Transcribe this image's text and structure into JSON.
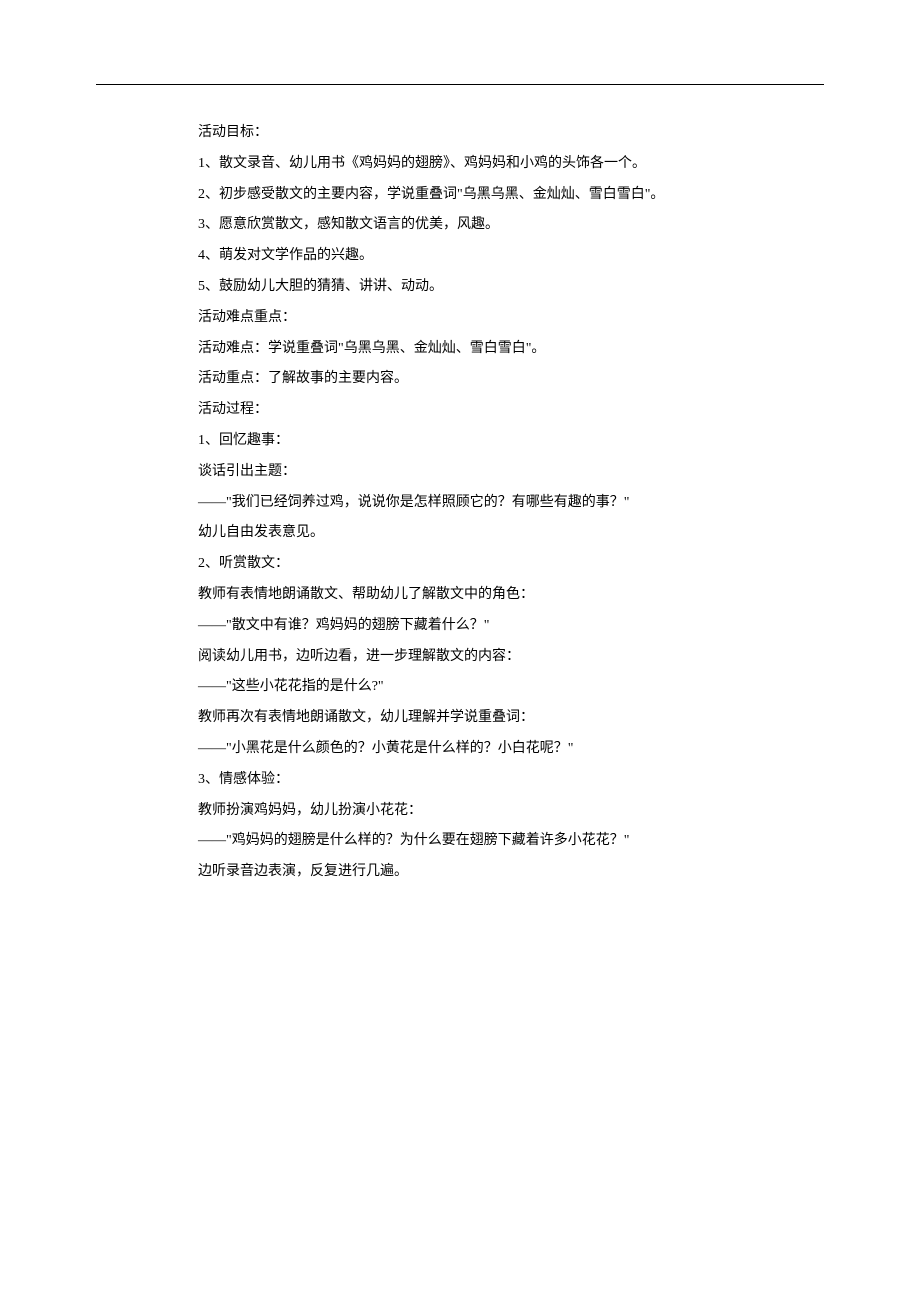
{
  "lines": [
    "活动目标：",
    "1、散文录音、幼儿用书《鸡妈妈的翅膀》、鸡妈妈和小鸡的头饰各一个。",
    "2、初步感受散文的主要内容，学说重叠词\"乌黑乌黑、金灿灿、雪白雪白\"。",
    "3、愿意欣赏散文，感知散文语言的优美，风趣。",
    "4、萌发对文学作品的兴趣。",
    "5、鼓励幼儿大胆的猜猜、讲讲、动动。",
    "活动难点重点：",
    "活动难点：学说重叠词\"乌黑乌黑、金灿灿、雪白雪白\"。",
    "活动重点：了解故事的主要内容。",
    "活动过程：",
    "1、回忆趣事：",
    "谈话引出主题：",
    "——\"我们已经饲养过鸡，说说你是怎样照顾它的？有哪些有趣的事？\"",
    "幼儿自由发表意见。",
    "2、听赏散文：",
    "教师有表情地朗诵散文、帮助幼儿了解散文中的角色：",
    "——\"散文中有谁？鸡妈妈的翅膀下藏着什么？\"",
    "阅读幼儿用书，边听边看，进一步理解散文的内容：",
    "——\"这些小花花指的是什么?\"",
    "教师再次有表情地朗诵散文，幼儿理解并学说重叠词：",
    "——\"小黑花是什么颜色的？小黄花是什么样的？小白花呢？\"",
    "3、情感体验：",
    "教师扮演鸡妈妈，幼儿扮演小花花：",
    "——\"鸡妈妈的翅膀是什么样的？为什么要在翅膀下藏着许多小花花？\"",
    "边听录音边表演，反复进行几遍。"
  ]
}
